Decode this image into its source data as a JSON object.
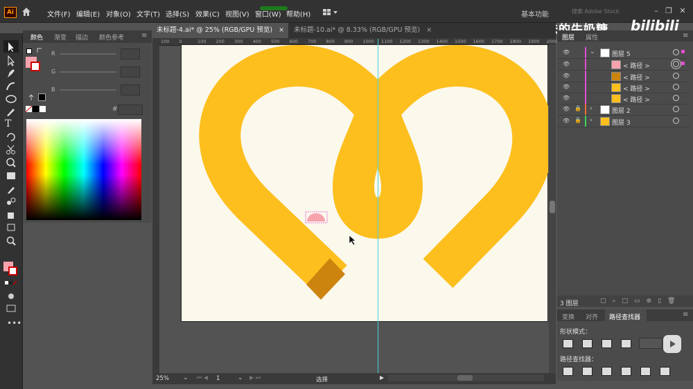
{
  "menubar": {
    "items": [
      "文件(F)",
      "编辑(E)",
      "对象(O)",
      "文字(T)",
      "选择(S)",
      "效果(C)",
      "视图(V)",
      "窗口(W)",
      "帮助(H)"
    ],
    "workspace": "基本功能",
    "search_placeholder": "搜索 Adobe Stock",
    "app_logo": "Ai"
  },
  "watermark": {
    "text": "抹茶味的牛奶糖_",
    "logo": "bilibili"
  },
  "color_panel": {
    "tabs": [
      "颜色",
      "渐变",
      "描边",
      "颜色参考"
    ],
    "channels": [
      "R",
      "G",
      "B"
    ],
    "hex_label": "#"
  },
  "document_tabs": [
    {
      "label": "未标题-4.ai* @ 25% (RGB/GPU 预览)",
      "active": true
    },
    {
      "label": "未标题-10.ai* @ 8.33% (RGB/GPU 预览)",
      "active": false
    }
  ],
  "ruler": {
    "ticks": [
      "100",
      "0",
      "100",
      "200",
      "300",
      "400",
      "500",
      "600",
      "700",
      "800",
      "900",
      "1000",
      "1100",
      "1200",
      "1300",
      "1400",
      "1500",
      "1600",
      "1700",
      "1800",
      "1900",
      "2000"
    ]
  },
  "statusbar": {
    "zoom": "25%",
    "page": "1",
    "tool": "选择"
  },
  "layers_panel": {
    "tabs": [
      "图层",
      "属性"
    ],
    "rows": [
      {
        "name": "图层 5",
        "kind": "layer",
        "expanded": true,
        "color": "#e34cd3"
      },
      {
        "name": "< 路径 >",
        "kind": "path",
        "color": "#e34cd3"
      },
      {
        "name": "< 路径 >",
        "kind": "path",
        "color": "#e34cd3"
      },
      {
        "name": "< 路径 >",
        "kind": "path",
        "color": "#e34cd3"
      },
      {
        "name": "< 路径 >",
        "kind": "path",
        "color": "#e34cd3"
      },
      {
        "name": "图层 2",
        "kind": "layer",
        "expanded": false,
        "locked": true,
        "color": "#f26b3a"
      },
      {
        "name": "图层 3",
        "kind": "layer",
        "expanded": false,
        "locked": true,
        "color": "#3bd45b"
      }
    ],
    "footer_count": "3 图层"
  },
  "pathfinder_panel": {
    "tabs": [
      "变换",
      "对齐",
      "路径查找器"
    ],
    "shape_modes_label": "形状模式：",
    "pathfinders_label": "路径查找器："
  },
  "colors": {
    "accent_yellow": "#fdbf1e",
    "dark_orange": "#cc840e",
    "pink": "#f7a3ad",
    "artboard": "#fbf8ec"
  }
}
